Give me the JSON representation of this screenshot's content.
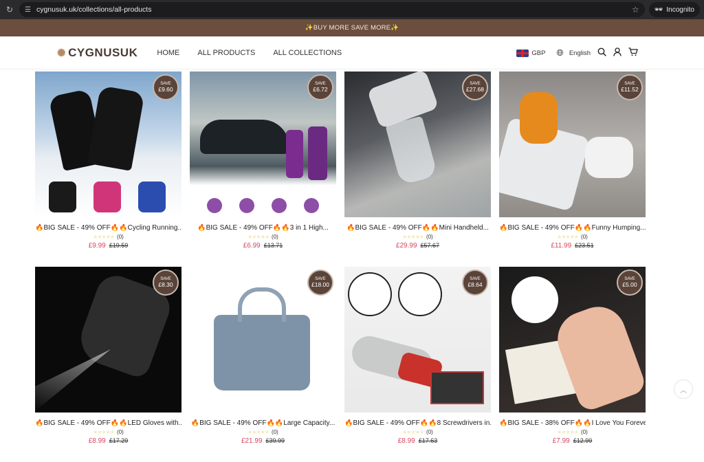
{
  "browser": {
    "url": "cygnusuk.uk/collections/all-products",
    "incognito_label": "Incognito",
    "icons": {
      "reload": "reload-icon",
      "site_settings": "tune-icon",
      "bookmark": "star-icon",
      "incognito": "incognito-icon"
    }
  },
  "announcement": "✨BUY MORE SAVE MORE✨",
  "header": {
    "logo_text": "CYGNUSUK",
    "nav": [
      "HOME",
      "ALL PRODUCTS",
      "ALL COLLECTIONS"
    ],
    "currency": "GBP",
    "language": "English",
    "icons": [
      "search-icon",
      "account-icon",
      "cart-icon"
    ]
  },
  "colors": {
    "announcement_bg": "#6b4e3d",
    "price": "#d8465b",
    "badge_bg": "#5a4338"
  },
  "products": [
    {
      "title": "🔥BIG SALE - 49% OFF🔥🔥Cycling Running...",
      "save_label": "SAVE",
      "save": "£9.60",
      "rating_count": "(0)",
      "price": "£9.99",
      "compare_price": "£19.59"
    },
    {
      "title": "🔥BIG SALE - 49% OFF🔥🔥3 in 1 High...",
      "save_label": "SAVE",
      "save": "£6.72",
      "rating_count": "(0)",
      "price": "£6.99",
      "compare_price": "£13.71"
    },
    {
      "title": "🔥BIG SALE - 49% OFF🔥🔥Mini Handheld...",
      "save_label": "SAVE",
      "save": "£27.68",
      "rating_count": "(0)",
      "price": "£29.99",
      "compare_price": "£57.67"
    },
    {
      "title": "🔥BIG SALE - 49% OFF🔥🔥Funny Humping...",
      "save_label": "SAVE",
      "save": "£11.52",
      "rating_count": "(0)",
      "price": "£11.99",
      "compare_price": "£23.51"
    },
    {
      "title": "🔥BIG SALE - 49% OFF🔥🔥LED Gloves with...",
      "save_label": "SAVE",
      "save": "£8.30",
      "rating_count": "(0)",
      "price": "£8.99",
      "compare_price": "£17.29"
    },
    {
      "title": "🔥BIG SALE - 49% OFF🔥🔥Large Capacity...",
      "save_label": "SAVE",
      "save": "£18.00",
      "rating_count": "(0)",
      "price": "£21.99",
      "compare_price": "£39.99"
    },
    {
      "title": "🔥BIG SALE - 49% OFF🔥🔥8 Screwdrivers in..",
      "save_label": "SAVE",
      "save": "£8.64",
      "rating_count": "(0)",
      "price": "£8.99",
      "compare_price": "£17.63"
    },
    {
      "title": "🔥BIG SALE - 38% OFF🔥🔥I Love You Foreve...",
      "save_label": "SAVE",
      "save": "£5.00",
      "rating_count": "(0)",
      "price": "£7.99",
      "compare_price": "£12.99"
    }
  ],
  "stars": "★★★★★",
  "scroll_top_icon": "chevron-up-icon"
}
